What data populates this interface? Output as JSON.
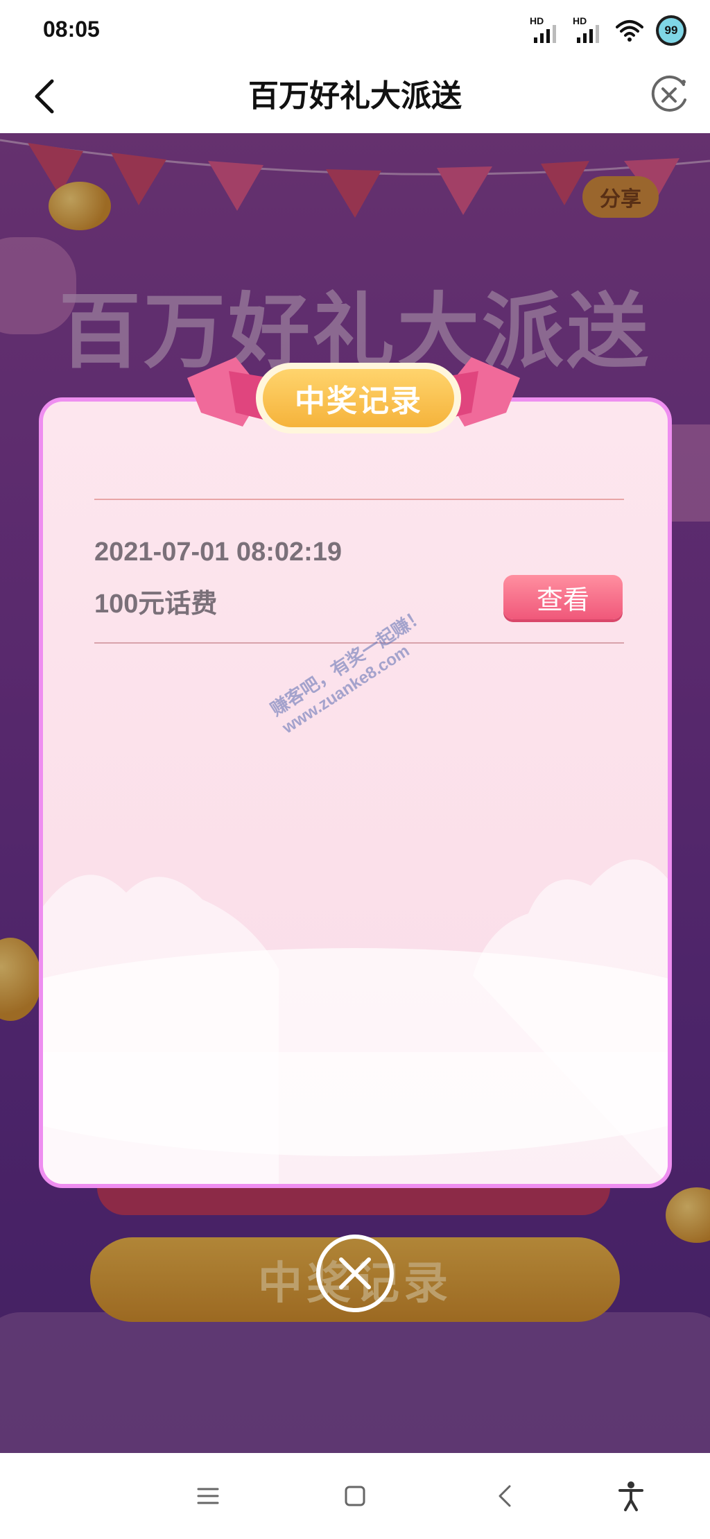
{
  "status_bar": {
    "time": "08:05",
    "signal_label": "HD",
    "battery": "99"
  },
  "title_bar": {
    "title": "百万好礼大派送"
  },
  "background": {
    "share_label": "分享",
    "title": "百万好礼大派送",
    "record_button_label": "中奖记录"
  },
  "modal": {
    "title": "中奖记录",
    "records": [
      {
        "time": "2021-07-01 08:02:19",
        "prize": "100元话费",
        "action_label": "查看"
      }
    ]
  },
  "watermark": {
    "line1": "赚客吧，有奖一起赚！",
    "line2": "www.zuanke8.com"
  },
  "colors": {
    "accent": "#f0587a",
    "modal_border": "#ee8ef0",
    "background": "#6c3184"
  }
}
